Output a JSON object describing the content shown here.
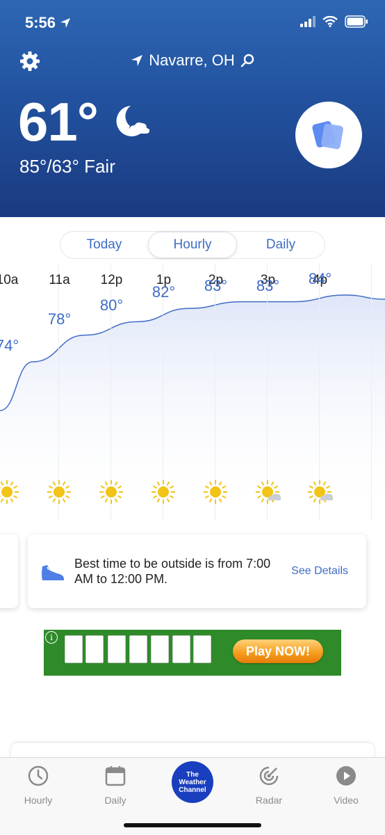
{
  "status_bar": {
    "time": "5:56"
  },
  "header": {
    "location": "Navarre, OH",
    "current_temp": "61°",
    "hi_lo_condition": "85°/63° Fair"
  },
  "tabs": [
    {
      "label": "Today",
      "active": false
    },
    {
      "label": "Hourly",
      "active": true
    },
    {
      "label": "Daily",
      "active": false
    }
  ],
  "hourly": [
    {
      "time": "10a",
      "temp": "74°",
      "value": 74,
      "icon": "sun-icon"
    },
    {
      "time": "11a",
      "temp": "78°",
      "value": 78,
      "icon": "sun-icon"
    },
    {
      "time": "12p",
      "temp": "80°",
      "value": 80,
      "icon": "sun-icon"
    },
    {
      "time": "1p",
      "temp": "82°",
      "value": 82,
      "icon": "sun-icon"
    },
    {
      "time": "2p",
      "temp": "83°",
      "value": 83,
      "icon": "sun-icon"
    },
    {
      "time": "3p",
      "temp": "83°",
      "value": 83,
      "icon": "partly-sunny-icon"
    },
    {
      "time": "4p",
      "temp": "84°",
      "value": 84,
      "icon": "partly-sunny-icon"
    }
  ],
  "best_time": {
    "text": "Best time to be outside is from 7:00 AM to 12:00 PM.",
    "link": "See Details"
  },
  "ad": {
    "button": "Play NOW!"
  },
  "tabbar": {
    "items": [
      {
        "label": "Hourly",
        "icon": "clock-icon"
      },
      {
        "label": "Daily",
        "icon": "calendar-icon"
      },
      {
        "label": "The Weather Channel",
        "icon": "twc-logo"
      },
      {
        "label": "Radar",
        "icon": "radar-icon"
      },
      {
        "label": "Video",
        "icon": "play-icon"
      }
    ]
  },
  "colors": {
    "header_top": "#2e67b4",
    "header_bottom": "#1a3a80",
    "accent": "#3d6cc4",
    "ad_green": "#2f8a2a"
  }
}
